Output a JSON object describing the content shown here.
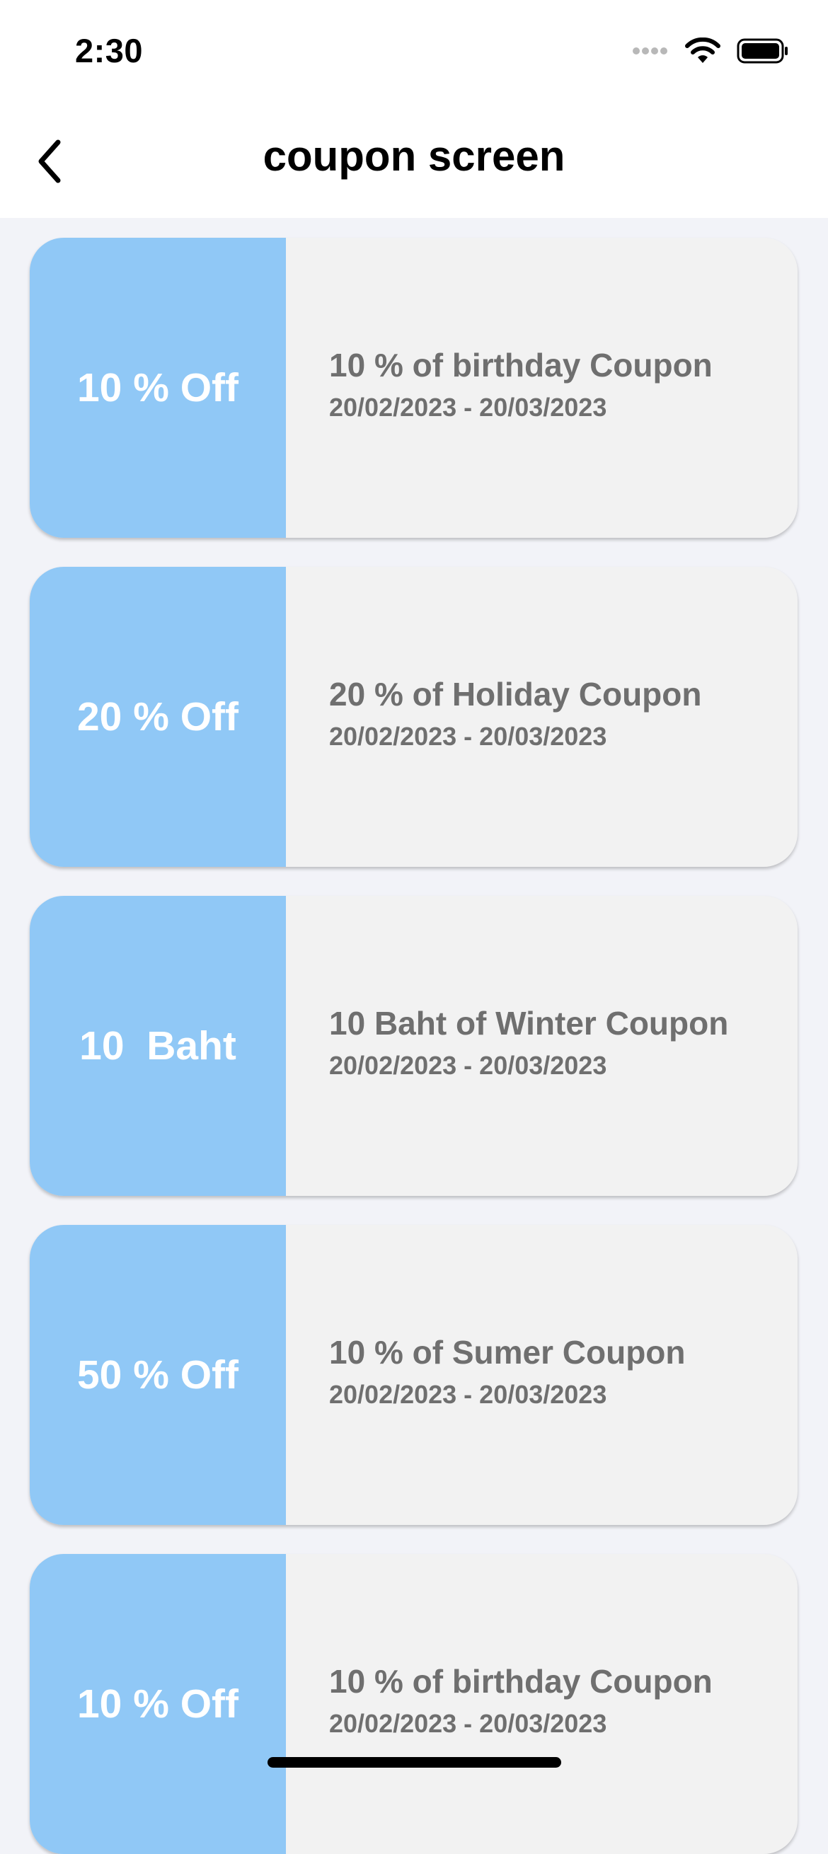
{
  "status_bar": {
    "time": "2:30",
    "icons": [
      "signal-icon",
      "wifi-icon",
      "battery-icon"
    ]
  },
  "nav": {
    "title": "coupon screen",
    "back_icon": "chevron-left-icon"
  },
  "colors": {
    "accent": "#90c8f6",
    "card_background": "#f2f2f2",
    "text_muted": "#6f6f6f",
    "page_background": "#f2f3f8"
  },
  "coupons": [
    {
      "amount": "10 % Off",
      "title": "10 % of birthday Coupon",
      "dates": "20/02/2023 - 20/03/2023"
    },
    {
      "amount": "20 % Off",
      "title": "20 % of Holiday Coupon",
      "dates": "20/02/2023 - 20/03/2023"
    },
    {
      "amount": "10  Baht",
      "title": "10 Baht of Winter Coupon",
      "dates": "20/02/2023 - 20/03/2023"
    },
    {
      "amount": "50 % Off",
      "title": "10 % of Sumer Coupon",
      "dates": "20/02/2023 - 20/03/2023"
    },
    {
      "amount": "10 % Off",
      "title": "10 % of birthday Coupon",
      "dates": "20/02/2023 - 20/03/2023"
    }
  ]
}
